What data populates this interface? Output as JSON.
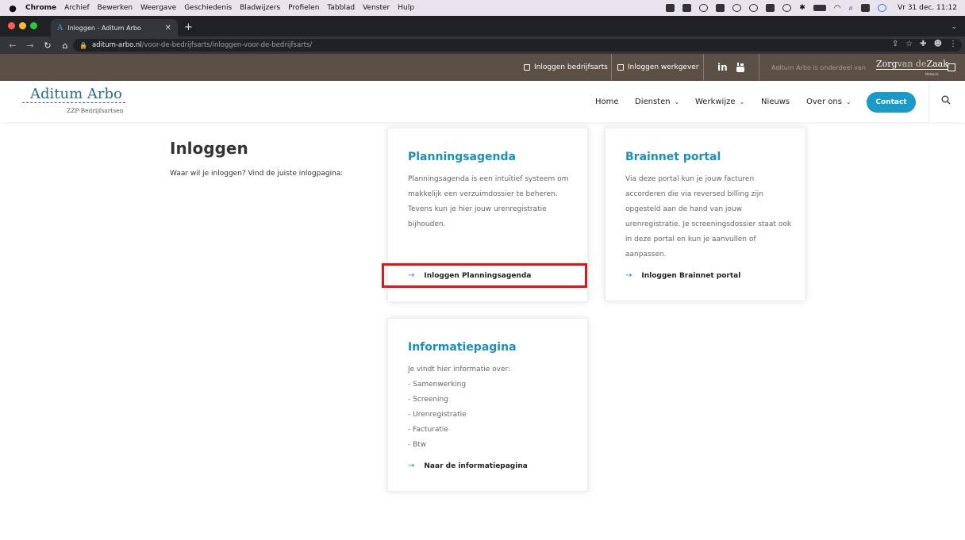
{
  "mac_menu": {
    "app": "Chrome",
    "items": [
      "Archief",
      "Bewerken",
      "Weergave",
      "Geschiedenis",
      "Bladwijzers",
      "Profielen",
      "Tabblad",
      "Venster",
      "Hulp"
    ],
    "clock": "Vr 31 dec. 11:12"
  },
  "browser": {
    "tab_title": "Inloggen - Aditum Arbo",
    "url_host": "aditum-arbo.nl",
    "url_path": "/voor-de-bedrijfsarts/inloggen-voor-de-bedrijfsarts/"
  },
  "topbar": {
    "login_doctor": "Inloggen bedrijfsarts",
    "login_employer": "Inloggen werkgever",
    "linkedin": "in",
    "youtube_icon": "youtube-icon",
    "note": "Aditum Arbo is onderdeel van",
    "brand_a": "Zorg",
    "brand_b": "van de",
    "brand_c": "Zaak",
    "brand_sub": "Netwerk"
  },
  "header": {
    "logo": "Aditum Arbo",
    "logo_sub": "ZZP-Bedrijfsartsen",
    "nav": {
      "home": "Home",
      "diensten": "Diensten",
      "werkwijze": "Werkwijze",
      "nieuws": "Nieuws",
      "over_ons": "Over ons",
      "contact": "Contact"
    }
  },
  "page": {
    "title": "Inloggen",
    "intro": "Waar wil je inloggen? Vind de juiste inlogpagina:"
  },
  "cards": {
    "planning": {
      "title": "Planningsagenda",
      "body": "Planningsagenda is een intuïtief systeem om makkelijk een verzuimdossier te beheren. Tevens kun je hier jouw urenregistratie bijhouden.",
      "link": "Inloggen Planningsagenda"
    },
    "brainnet": {
      "title": "Brainnet portal",
      "body": "Via deze portal kun je jouw facturen accorderen die via reversed billing zijn opgesteld aan de hand van jouw urenregistratie. Je screeningsdossier staat ook in deze portal en kun je aanvullen of aanpassen.",
      "link": "Inloggen Brainnet portal"
    },
    "info": {
      "title": "Informatiepagina",
      "intro": "Je vindt hier informatie over:",
      "items": [
        "- Samenwerking",
        "- Screening",
        "- Urenregistratie",
        "- Facturatie",
        "- Btw"
      ],
      "link": "Naar de informatiepagina"
    }
  },
  "colors": {
    "accent": "#1a9ac8",
    "topbar": "#5b4f46",
    "highlight": "#e0141b"
  }
}
